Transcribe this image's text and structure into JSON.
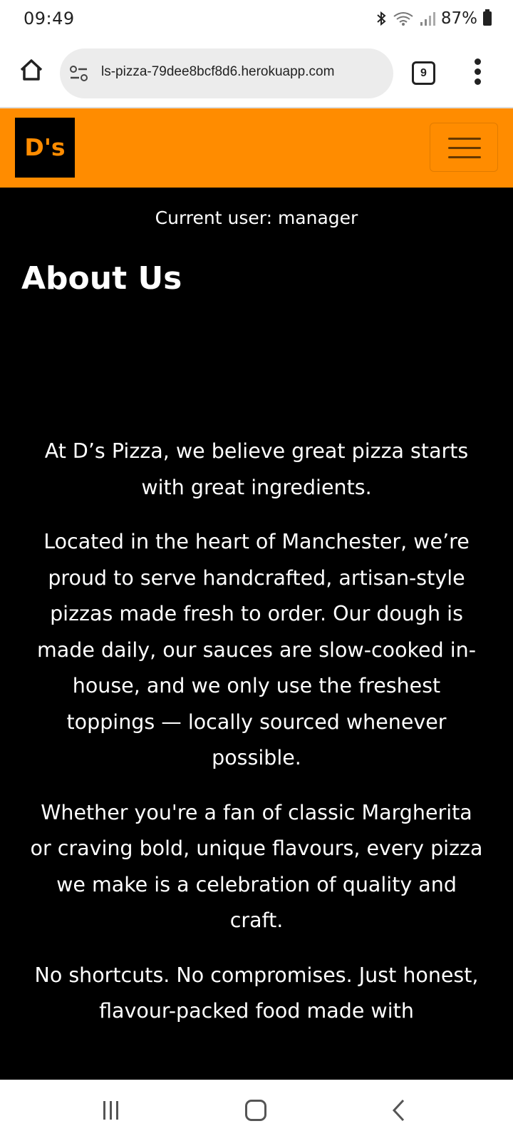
{
  "status_bar": {
    "time": "09:49",
    "battery": "87%",
    "icons": [
      "bluetooth-icon",
      "wifi-icon",
      "signal-icon",
      "battery-icon"
    ]
  },
  "browser": {
    "url": "ls-pizza-79dee8bcf8d6.herokuapp.com",
    "tab_count": "9"
  },
  "navbar": {
    "logo_text": "D's",
    "accent_color": "#ff8c00"
  },
  "page": {
    "current_user": "Current user: manager",
    "title": "About Us",
    "paragraphs": [
      "At D’s Pizza, we believe great pizza starts with great ingredients.",
      "Located in the heart of Manchester, we’re proud to serve handcrafted, artisan-style pizzas made fresh to order. Our dough is made daily, our sauces are slow-cooked in-house, and we only use the freshest toppings — locally sourced whenever possible.",
      "Whether you're a fan of classic Margherita or craving bold, unique flavours, every pizza we make is a celebration of quality and craft.",
      "No shortcuts. No compromises. Just honest, flavour-packed food made with"
    ]
  }
}
